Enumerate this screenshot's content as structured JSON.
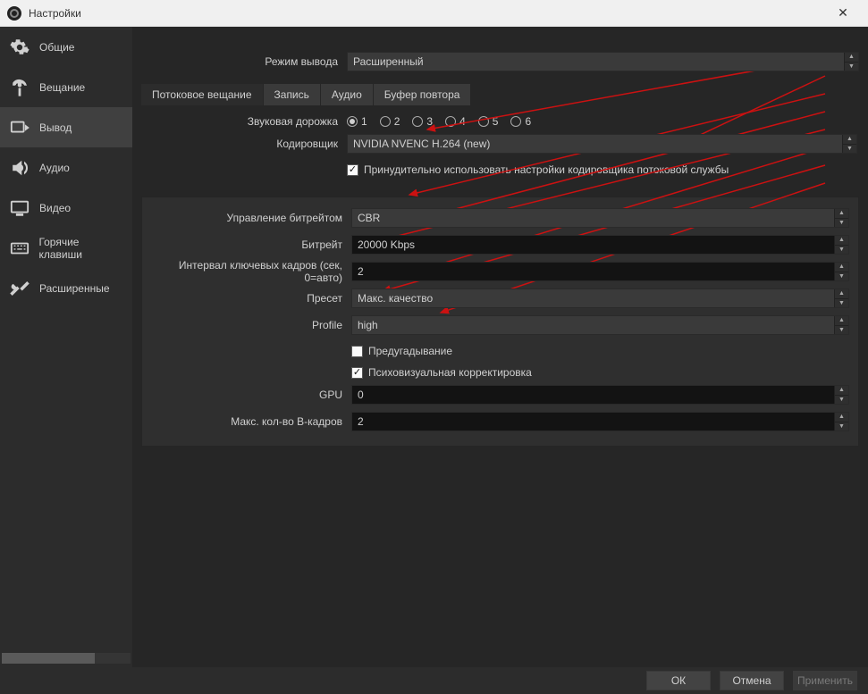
{
  "window": {
    "title": "Настройки"
  },
  "sidebar": {
    "items": [
      {
        "label": "Общие"
      },
      {
        "label": "Вещание"
      },
      {
        "label": "Вывод"
      },
      {
        "label": "Аудио"
      },
      {
        "label": "Видео"
      },
      {
        "label": "Горячие клавиши"
      },
      {
        "label": "Расширенные"
      }
    ]
  },
  "output_mode": {
    "label": "Режим вывода",
    "value": "Расширенный"
  },
  "tabs": [
    {
      "label": "Потоковое вещание"
    },
    {
      "label": "Запись"
    },
    {
      "label": "Аудио"
    },
    {
      "label": "Буфер повтора"
    }
  ],
  "audio_track": {
    "label": "Звуковая дорожка",
    "options": [
      "1",
      "2",
      "3",
      "4",
      "5",
      "6"
    ],
    "selected": "1"
  },
  "encoder": {
    "label": "Кодировщик",
    "value": "NVIDIA NVENC H.264 (new)"
  },
  "enforce": {
    "label": "Принудительно использовать настройки кодировщика потоковой службы"
  },
  "rate_control": {
    "label": "Управление битрейтом",
    "value": "CBR"
  },
  "bitrate": {
    "label": "Битрейт",
    "value": "20000 Kbps"
  },
  "keyint": {
    "label": "Интервал ключевых кадров (сек, 0=авто)",
    "value": "2"
  },
  "preset": {
    "label": "Пресет",
    "value": "Макс. качество"
  },
  "profile": {
    "label": "Profile",
    "value": "high"
  },
  "lookahead": {
    "label": "Предугадывание"
  },
  "psycho": {
    "label": "Психовизуальная корректировка"
  },
  "gpu": {
    "label": "GPU",
    "value": "0"
  },
  "bframes": {
    "label": "Макс. кол-во B-кадров",
    "value": "2"
  },
  "footer": {
    "ok": "ОК",
    "cancel": "Отмена",
    "apply": "Применить"
  }
}
